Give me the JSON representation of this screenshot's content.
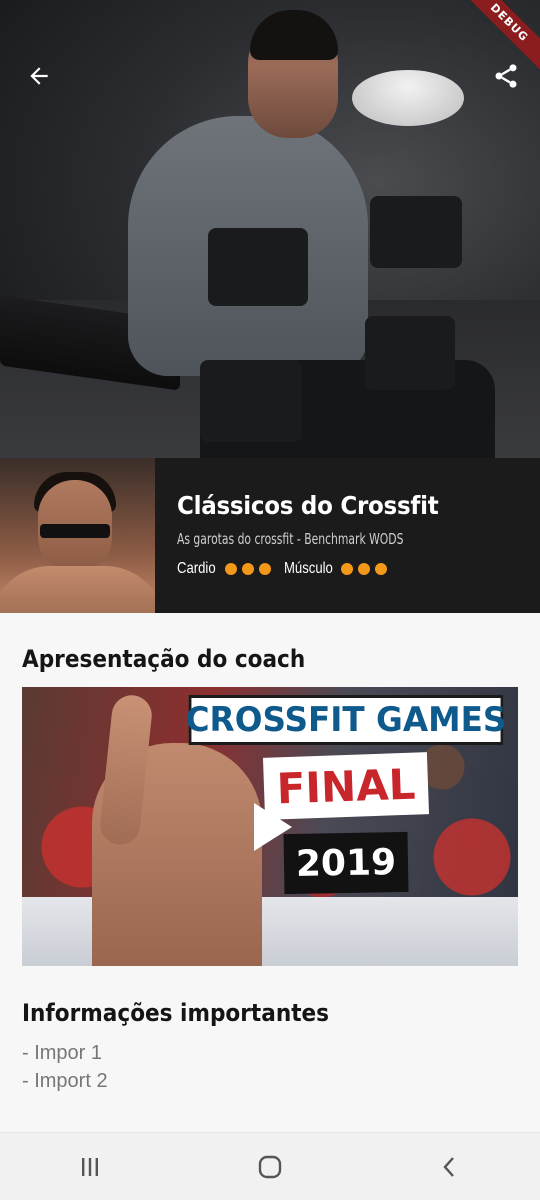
{
  "debug_banner": "DEBUG",
  "header": {
    "back_icon": "arrow-left-icon",
    "share_icon": "share-icon"
  },
  "program": {
    "title": "Clássicos do Crossfit",
    "subtitle": "As garotas do crossfit - Benchmark WODS",
    "meters": [
      {
        "label": "Cardio",
        "level": 3,
        "max": 3
      },
      {
        "label": "Músculo",
        "level": 3,
        "max": 3
      }
    ],
    "accent_color": "#f4981a"
  },
  "coach_section": {
    "title": "Apresentação do coach",
    "video": {
      "line1": "CROSSFIT GAMES",
      "line2": "FINAL",
      "line3": "2019",
      "play_icon": "play-icon"
    }
  },
  "info_section": {
    "title": "Informações importantes",
    "items": [
      "- Impor 1",
      "- Import 2"
    ]
  },
  "navbar": {
    "recent_icon": "recent-apps-icon",
    "home_icon": "home-icon",
    "back_icon": "nav-back-icon"
  }
}
